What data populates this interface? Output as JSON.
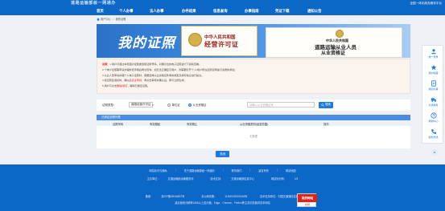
{
  "header": {
    "site_title": "道路运输部级一网通办",
    "portal_link": "全国一体化政务服务平台"
  },
  "nav": {
    "items": [
      "首页",
      "个人办事",
      "法人办事",
      "办件结果",
      "信息查询",
      "办事指南",
      "凭证下载",
      "通知公告"
    ]
  },
  "breadcrumb": {
    "items": [
      "用户中心",
      "我的证照"
    ]
  },
  "banner": {
    "title": "我的证照",
    "cert1_line1": "中华人民共和国",
    "cert1_line2": "经营许可证",
    "cert2_line1": "中华人民共和国",
    "cert2_line2": "道路运输从业人员",
    "cert2_line3": "从业资格证"
  },
  "notice": {
    "label": "说明：",
    "lines": [
      "1.用户可通过本页面对证照类型和证照号码，对展示出的电子证照进行下载和查看。",
      "2.个体户证照需申请办理新增手续后再次查询，如无法正确显示用户，则需要打开个人/用户所在证照证明进行资质的添加。",
      "3.从业人员申请办理个人电子证照时，需要选择从业资格证件库的类型及填写信息进行提交。",
      "4.经证照签发机构，确认后",
      "5.用户可点击"
    ],
    "line4_red": "自主申领，",
    "line4_tail": "再点击审核并确认后，即可立即生成。",
    "line5_red": "删除/绑定",
    "line5_tail": "，解除已绑定证照。"
  },
  "filter": {
    "type_label": "证照类型：",
    "type_value": "道路经营许可证",
    "radio_options": [
      "单位证",
      "从业资格证"
    ],
    "radio_selected": 1,
    "search_placeholder": "请输入从业资格证号",
    "search_button": "搜索"
  },
  "table": {
    "caption": "已绑定证照列表",
    "columns": [
      "证照号码",
      "有效期起",
      "有效期止",
      "从业资格类别(经营范围)",
      "操作"
    ],
    "empty_text": "无数据"
  },
  "actions": {
    "close_button": "关闭"
  },
  "footer": {
    "links": [
      "网站标识与隐私",
      "关于道路运输部级一网通办",
      "联系我们",
      "留言有效",
      "网站地图"
    ],
    "sponsor_label": "主办单位：",
    "sponsor_value": "交通运输部运输服务司",
    "tech_label": "技术支持：",
    "tech_value": "交通运输部信息中心",
    "site_code_label": "网站标识码：",
    "site_code_value": "1/1",
    "icp_label": "备案：",
    "icp_value": "京ICP备05046837号",
    "police_label": "京公网安备：",
    "police_value": "11000102000148号",
    "tech_support": "技术支持单位：中国交通通信信息中心",
    "browser_line": "建议使用分辨率1366以上显示器，Edge、Chrome、Firefox等主流浏览器浏览本网站",
    "badge_top": "政府网站",
    "badge_bottom": "找错"
  },
  "side_panel": {
    "items": [
      "统一登录",
      "我的收藏",
      "我的办事",
      "交通服务",
      "帮助中心",
      "服务热线"
    ]
  }
}
